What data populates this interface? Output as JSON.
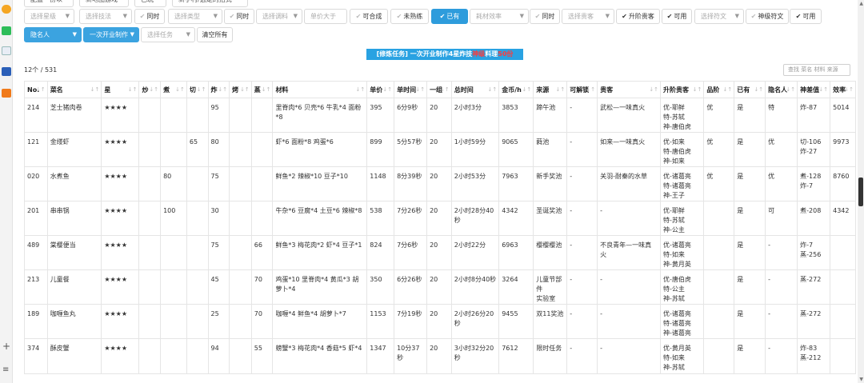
{
  "topRow": [
    "配置一份以",
    "新地图游戏",
    "已玩",
    "新手村/选定的招式",
    "已完成地图"
  ],
  "filters": {
    "grade": {
      "placeholder": "选择星级"
    },
    "skill": {
      "placeholder": "选择技法"
    },
    "sametime1": "同时",
    "type": {
      "placeholder": "选择类型"
    },
    "sametime2": "同时",
    "ingredient": {
      "placeholder": "选择调料"
    },
    "price_gt": {
      "placeholder": "单价大于"
    },
    "craftable": "可合成",
    "unfamiliar": "未熟练",
    "owned": "已有",
    "efficiency": {
      "placeholder": "耗材效率"
    },
    "sametime3": "同时",
    "guest": {
      "placeholder": "选择贵客"
    },
    "upgrade_guest": "升阶贵客",
    "available1": "可用",
    "rune": {
      "placeholder": "选择符文"
    },
    "divine_rune": "神级符文",
    "available2": "可用",
    "chef": "隐名人",
    "task_select": "一次开业制作",
    "task": {
      "placeholder": "选择任务"
    },
    "clear_all": "清空所有"
  },
  "banner": {
    "prefix": "[修炼任务] 一次开业制作4星炸技",
    "highlight": "神级",
    "middle": "料理",
    "count": "50份"
  },
  "count": "12个 / 531",
  "search_placeholder": "查找 菜名 材料 来源",
  "columns": [
    "No.",
    "菜名",
    "星",
    "炒",
    "煮",
    "切",
    "炸",
    "烤",
    "蒸",
    "材料",
    "单价",
    "单时间",
    "一组",
    "总时间",
    "金币/h",
    "来源",
    "可解锁",
    "贵客",
    "升阶贵客",
    "品阶",
    "已有",
    "隐名人",
    "神差值",
    "效率"
  ],
  "rows": [
    {
      "no": "214",
      "name": "芝士猪肉卷",
      "star": "★★★★",
      "chao": "",
      "zhu": "",
      "qie": "",
      "zha": "95",
      "kao": "",
      "zheng": "",
      "mat": "里脊肉*6 贝壳*6 牛乳*4 面粉*8",
      "price": "395",
      "time": "6分9秒",
      "group": "20",
      "total": "2小时3分",
      "gold": "3853",
      "src": "蹄午池",
      "unlock": "-",
      "guest": "武松—一味真火",
      "up": "优-耶鲜\n特-苏轼\n神-唐伯虎",
      "grade": "优",
      "owned": "是",
      "hidden": "特",
      "diff": "炸-87",
      "eff": "5014"
    },
    {
      "no": "121",
      "name": "金缕虾",
      "star": "★★★★",
      "chao": "",
      "zhu": "",
      "qie": "65",
      "zha": "80",
      "kao": "",
      "zheng": "",
      "mat": "虾*6 面粉*8 鸡蛋*6",
      "price": "899",
      "time": "5分57秒",
      "group": "20",
      "total": "1小时59分",
      "gold": "9065",
      "src": "蕤池",
      "unlock": "-",
      "guest": "如来—一味真火",
      "up": "优-如来\n特-唐伯虎\n神-如来",
      "grade": "优",
      "owned": "是",
      "hidden": "优",
      "diff": "切-106\n炸-27",
      "eff": "9973"
    },
    {
      "no": "020",
      "name": "水煮鱼",
      "star": "★★★★",
      "chao": "",
      "zhu": "80",
      "qie": "",
      "zha": "75",
      "kao": "",
      "zheng": "",
      "mat": "鲜鱼*2 辣椒*10 豆子*10",
      "price": "1148",
      "time": "8分39秒",
      "group": "20",
      "total": "2小时53分",
      "gold": "7963",
      "src": "新手奖池",
      "unlock": "-",
      "guest": "关羽-耐秦的水草",
      "up": "优-诸葛亮\n特-诸葛亮\n神-王子",
      "grade": "优",
      "owned": "是",
      "hidden": "优",
      "diff": "煮-128\n炸-7",
      "eff": "8760"
    },
    {
      "no": "201",
      "name": "串串锅",
      "star": "★★★★",
      "chao": "",
      "zhu": "100",
      "qie": "",
      "zha": "30",
      "kao": "",
      "zheng": "",
      "mat": "牛杂*6 豆腐*4 土豆*6 辣椒*8",
      "price": "538",
      "time": "7分26秒",
      "group": "20",
      "total": "2小时28分40秒",
      "gold": "4342",
      "src": "圣诞奖池",
      "unlock": "-",
      "guest": "-",
      "up": "优-耶鲜\n特-苏轼\n神-公主",
      "grade": "",
      "owned": "是",
      "hidden": "可",
      "diff": "煮-208",
      "eff": "4342"
    },
    {
      "no": "489",
      "name": "棠樱便当",
      "star": "★★★★",
      "chao": "",
      "zhu": "",
      "qie": "",
      "zha": "75",
      "kao": "",
      "zheng": "66",
      "mat": "鲜鱼*3 梅花肉*2 虾*4 豆子*1",
      "price": "824",
      "time": "7分6秒",
      "group": "20",
      "total": "2小时22分",
      "gold": "6963",
      "src": "樱樱樱池",
      "unlock": "-",
      "guest": "不良青年—一味真火",
      "up": "优-诸葛亮\n特-如来\n神-黄月英",
      "grade": "",
      "owned": "是",
      "hidden": "-",
      "diff": "炸-7\n蒸-256",
      "eff": ""
    },
    {
      "no": "213",
      "name": "儿童餐",
      "star": "★★★★",
      "chao": "",
      "zhu": "",
      "qie": "",
      "zha": "45",
      "kao": "",
      "zheng": "70",
      "mat": "鸡蛋*10 里脊肉*4 黄瓜*3 胡萝卜*4",
      "price": "350",
      "time": "6分26秒",
      "group": "20",
      "total": "2小时8分40秒",
      "gold": "3264",
      "src": "儿童节部件\n实验室",
      "unlock": "-",
      "guest": "-",
      "up": "优-唐伯虎\n特-公主\n神-苏轼",
      "grade": "",
      "owned": "是",
      "hidden": "-",
      "diff": "蒸-272",
      "eff": ""
    },
    {
      "no": "189",
      "name": "咖喱鱼丸",
      "star": "★★★★",
      "chao": "",
      "zhu": "",
      "qie": "",
      "zha": "25",
      "kao": "",
      "zheng": "70",
      "mat": "咖喱*4 鲜鱼*4 胡萝卜*7",
      "price": "1153",
      "time": "7分19秒",
      "group": "20",
      "total": "2小时26分20秒",
      "gold": "9455",
      "src": "双11奖池",
      "unlock": "-",
      "guest": "-",
      "up": "优-诸葛亮\n特-诸葛亮\n神-诸葛亮",
      "grade": "",
      "owned": "是",
      "hidden": "-",
      "diff": "蒸-272",
      "eff": ""
    },
    {
      "no": "374",
      "name": "酥皮蟹",
      "star": "★★★★",
      "chao": "",
      "zhu": "",
      "qie": "",
      "zha": "94",
      "kao": "",
      "zheng": "55",
      "mat": "螃蟹*3 梅花肉*4 香菇*5 虾*4",
      "price": "1347",
      "time": "10分37秒",
      "group": "20",
      "total": "3小时32分20秒",
      "gold": "7612",
      "src": "限时任务",
      "unlock": "-",
      "guest": "-",
      "up": "优-黄月英\n特-如来\n神-苏轼",
      "grade": "",
      "owned": "是",
      "hidden": "-",
      "diff": "炸-83\n蒸-212",
      "eff": ""
    }
  ]
}
